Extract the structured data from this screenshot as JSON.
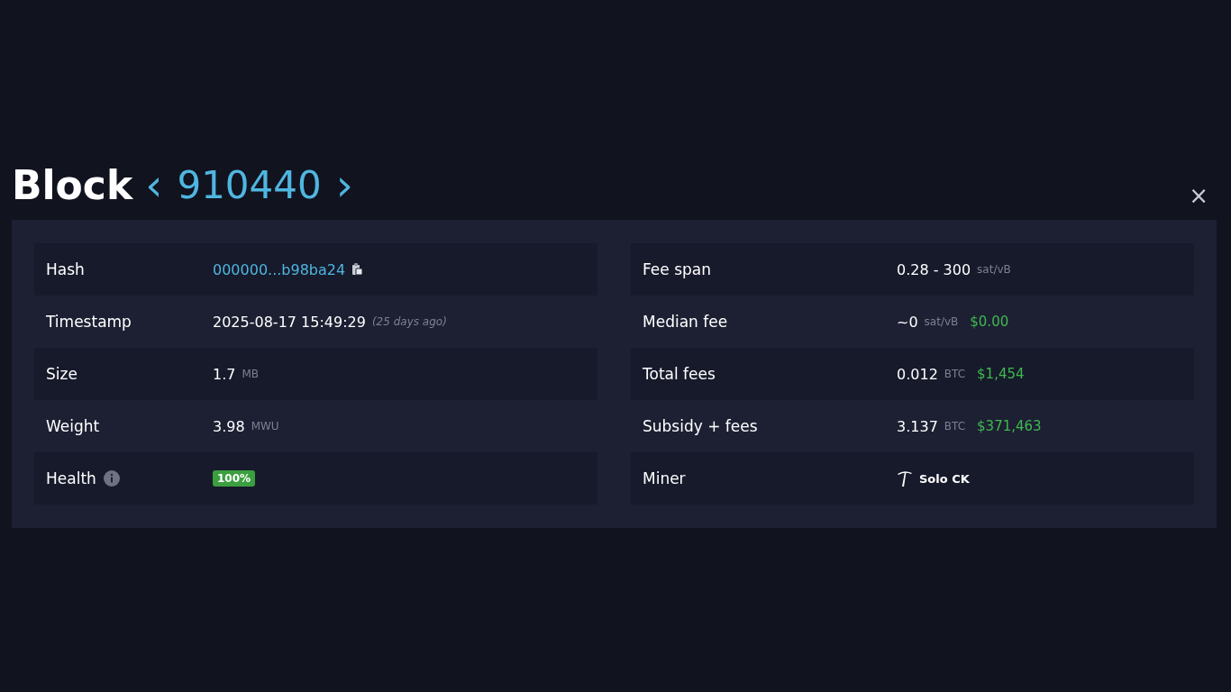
{
  "header": {
    "title": "Block",
    "block_number": "910440",
    "prev": "‹",
    "next": "›",
    "close": "×"
  },
  "columns": [
    {
      "rows": [
        {
          "label": "Hash",
          "kind": "hash",
          "parts": [
            {
              "text": "000000...b98ba24",
              "kind": "link"
            }
          ]
        },
        {
          "label": "Timestamp",
          "kind": "plain",
          "parts": [
            {
              "text": "2025-08-17 15:49:29",
              "kind": "main"
            },
            {
              "text": "(25 days ago)",
              "kind": "note"
            }
          ]
        },
        {
          "label": "Size",
          "kind": "plain",
          "parts": [
            {
              "text": "1.7",
              "kind": "main"
            },
            {
              "text": "MB",
              "kind": "unit"
            }
          ]
        },
        {
          "label": "Weight",
          "kind": "plain",
          "parts": [
            {
              "text": "3.98",
              "kind": "main"
            },
            {
              "text": "MWU",
              "kind": "unit"
            }
          ]
        },
        {
          "label": "Health",
          "kind": "health",
          "parts": [
            {
              "text": "100%",
              "kind": "badge"
            }
          ]
        }
      ]
    },
    {
      "rows": [
        {
          "label": "Fee span",
          "kind": "plain",
          "parts": [
            {
              "text": "0.28 - 300",
              "kind": "main"
            },
            {
              "text": "sat/vB",
              "kind": "unit"
            }
          ]
        },
        {
          "label": "Median fee",
          "kind": "plain",
          "parts": [
            {
              "text": "~0",
              "kind": "main"
            },
            {
              "text": "sat/vB",
              "kind": "unit"
            },
            {
              "text": "$0.00",
              "kind": "fiat"
            }
          ]
        },
        {
          "label": "Total fees",
          "kind": "plain",
          "parts": [
            {
              "text": "0.012",
              "kind": "main"
            },
            {
              "text": "BTC",
              "kind": "unit"
            },
            {
              "text": "$1,454",
              "kind": "fiat"
            }
          ]
        },
        {
          "label": "Subsidy + fees",
          "kind": "plain",
          "parts": [
            {
              "text": "3.137",
              "kind": "main"
            },
            {
              "text": "BTC",
              "kind": "unit"
            },
            {
              "text": "$371,463",
              "kind": "fiat"
            }
          ]
        },
        {
          "label": "Miner",
          "kind": "miner",
          "parts": [
            {
              "text": "Solo CK",
              "kind": "main"
            }
          ]
        }
      ]
    }
  ]
}
